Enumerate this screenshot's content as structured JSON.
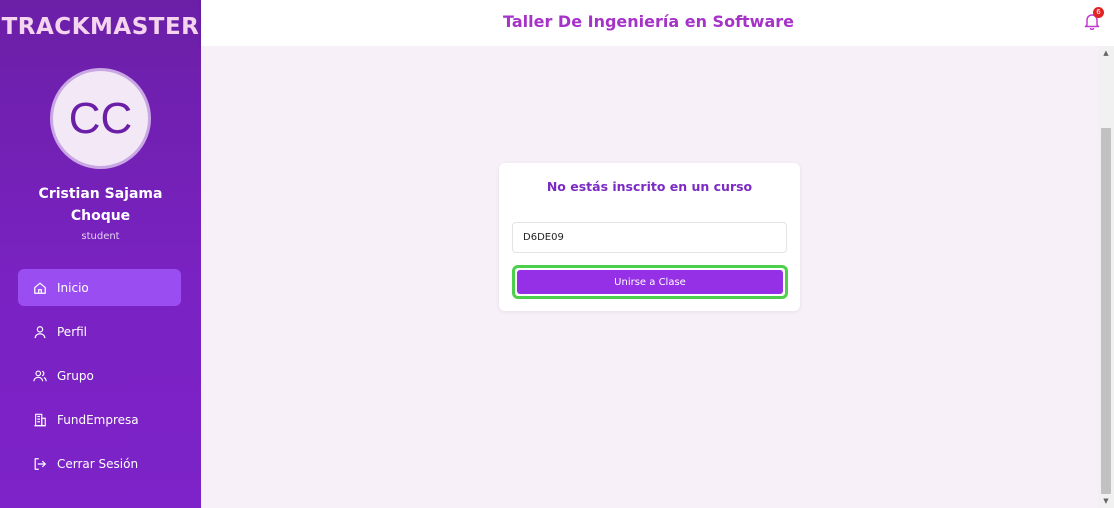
{
  "sidebar": {
    "brand": "TRACKMASTER",
    "avatar_initials": "CC",
    "user_name": "Cristian Sajama Choque",
    "user_role": "student",
    "items": [
      {
        "label": "Inicio",
        "icon": "home-icon",
        "active": true
      },
      {
        "label": "Perfil",
        "icon": "user-icon",
        "active": false
      },
      {
        "label": "Grupo",
        "icon": "users-icon",
        "active": false
      },
      {
        "label": "FundEmpresa",
        "icon": "building-icon",
        "active": false
      },
      {
        "label": "Cerrar Sesión",
        "icon": "logout-icon",
        "active": false
      }
    ]
  },
  "header": {
    "title": "Taller De Ingeniería en Software",
    "notification_count": "6"
  },
  "card": {
    "title": "No estás inscrito en un curso",
    "code_value": "D6DE09",
    "join_label": "Unirse a Clase"
  },
  "colors": {
    "sidebar": "#7a22c2",
    "active_item": "#9a4df0",
    "title": "#a633c8",
    "button": "#9530e6",
    "highlight": "#4cd04c",
    "badge": "#e02424"
  }
}
